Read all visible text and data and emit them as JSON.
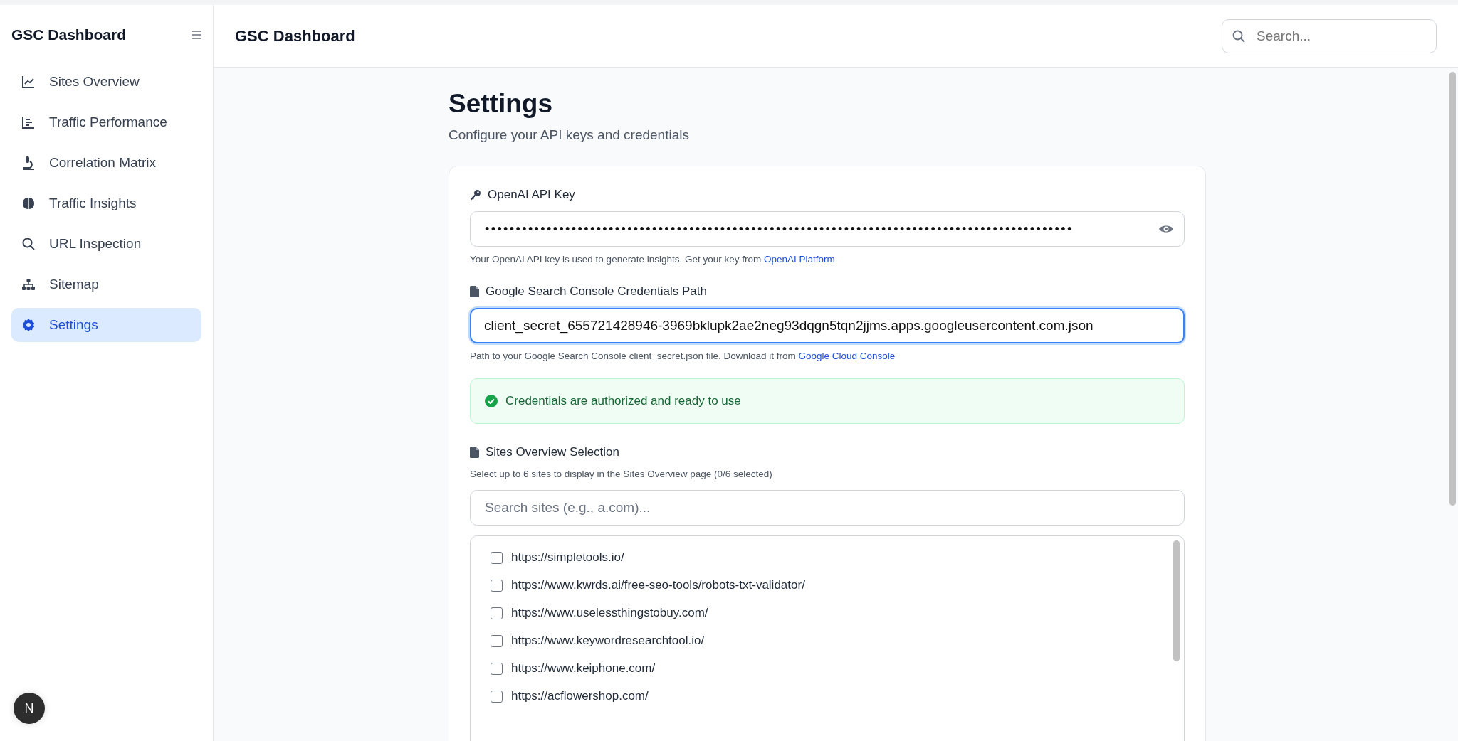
{
  "sidebar": {
    "title": "GSC Dashboard",
    "items": [
      {
        "label": "Sites Overview",
        "kind": "linechart",
        "selected": false
      },
      {
        "label": "Traffic Performance",
        "kind": "barchart",
        "selected": false
      },
      {
        "label": "Correlation Matrix",
        "kind": "microscope",
        "selected": false
      },
      {
        "label": "Traffic Insights",
        "kind": "brain",
        "selected": false
      },
      {
        "label": "URL Inspection",
        "kind": "search",
        "selected": false
      },
      {
        "label": "Sitemap",
        "kind": "sitemap",
        "selected": false
      },
      {
        "label": "Settings",
        "kind": "settings",
        "selected": true
      }
    ]
  },
  "header": {
    "title": "GSC Dashboard",
    "search": {
      "placeholder": "Search..."
    }
  },
  "page": {
    "title": "Settings",
    "subtitle": "Configure your API keys and credentials"
  },
  "openai": {
    "label": "OpenAI API Key",
    "value": "•••••••••••••••••••••••••••••••••••••••••••••••••••••••••••••••••••••••••••••••••••••••••••••••",
    "help": "Your OpenAI API key is used to generate insights. Get your key from",
    "link": "OpenAI Platform"
  },
  "credentials": {
    "label": "Google Search Console Credentials Path",
    "value": "client_secret_655721428946-3969bklupk2ae2neg93dqgn5tqn2jjms.apps.googleusercontent.com.json",
    "help": "Path to your Google Search Console client_secret.json file. Download it from",
    "link": "Google Cloud Console"
  },
  "status": {
    "kind": "success",
    "text": "Credentials are authorized and ready to use"
  },
  "sites": {
    "label": "Sites Overview Selection",
    "help": "Select up to 6 sites to display in the Sites Overview page (0/6 selected)",
    "search": {
      "placeholder": "Search sites (e.g., a.com)..."
    },
    "items": [
      {
        "url": "https://simpletools.io/",
        "checked": false
      },
      {
        "url": "https://www.kwrds.ai/free-seo-tools/robots-txt-validator/",
        "checked": false
      },
      {
        "url": "https://www.uselessthingstobuy.com/",
        "checked": false
      },
      {
        "url": "https://www.keywordresearchtool.io/",
        "checked": false
      },
      {
        "url": "https://www.keiphone.com/",
        "checked": false
      },
      {
        "url": "https://acflowershop.com/",
        "checked": false
      }
    ]
  },
  "dev_badge": {
    "text": "N"
  }
}
